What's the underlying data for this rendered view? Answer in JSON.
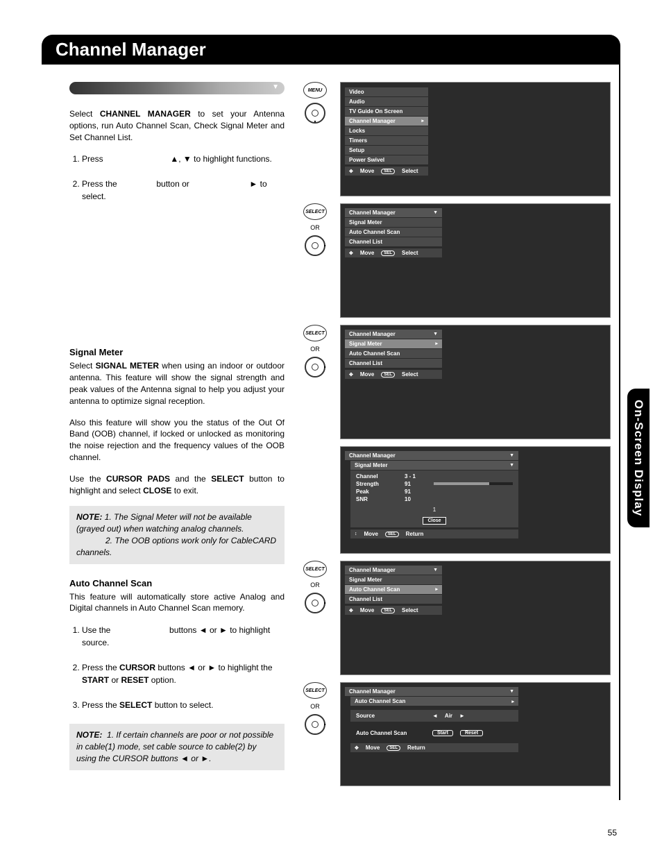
{
  "header": {
    "title": "Channel Manager"
  },
  "side_tab": "On-Screen Display",
  "page_number": "55",
  "intro": {
    "prefix": "Select ",
    "bold": "CHANNEL MANAGER",
    "suffix": " to set your Antenna options, run Auto Channel Scan, Check Signal Meter and Set Channel List."
  },
  "steps_main": {
    "s1_pre": "Press ",
    "s1_mid": ", ",
    "s1_post": " to highlight functions.",
    "s2_pre": "Press the ",
    "s2_mid": " button or ",
    "s2_post": " to select."
  },
  "up": "▲",
  "down": "▼",
  "left": "◄",
  "right": "►",
  "signal_meter": {
    "heading": "Signal Meter",
    "p1_pre": "Select ",
    "p1_bold": "SIGNAL METER",
    "p1_post": " when using an indoor or outdoor antenna. This feature will show the signal strength and peak values of the Antenna signal to help you adjust your antenna to optimize signal reception.",
    "p2": "Also this feature will show you the status of the Out Of Band (OOB) channel, if locked or unlocked as monitoring the noise rejection and the frequency values of the OOB channel.",
    "p3_a": "Use the ",
    "p3_b": "CURSOR PADS",
    "p3_c": " and the ",
    "p3_d": "SELECT",
    "p3_e": " button to highlight and select ",
    "p3_f": "CLOSE",
    "p3_g": " to exit.",
    "note_label": "NOTE:",
    "note1": "1. The Signal Meter will not be available (grayed out) when watching analog channels.",
    "note2": "2. The OOB options work only for CableCARD channels."
  },
  "auto_scan": {
    "heading": "Auto Channel Scan",
    "p1": "This feature will automatically store active Analog and Digital channels in Auto Channel Scan memory.",
    "s1_a": "Use the ",
    "s1_b": " buttons ",
    "s1_c": " or ",
    "s1_d": " to highlight source.",
    "s2_a": "Press the ",
    "s2_b": "CURSOR",
    "s2_c": " buttons ",
    "s2_d": " or ",
    "s2_e": " to highlight the ",
    "s2_f": "START",
    "s2_g": " or ",
    "s2_h": "RESET",
    "s2_i": " option.",
    "s3_a": "Press the ",
    "s3_b": "SELECT",
    "s3_c": " button to select.",
    "note_label": "NOTE:",
    "note1_a": "1. If certain channels are poor or not possible in cable(1) mode, set cable source to cable(2) by using the CURSOR buttons ",
    "note1_b": " or ",
    "note1_c": "."
  },
  "screens": {
    "main_menu": {
      "items": [
        "Video",
        "Audio",
        "TV Guide On Screen",
        "Channel Manager",
        "Locks",
        "Timers",
        "Setup",
        "Power Swivel"
      ],
      "selected_index": 3,
      "footer_move": "Move",
      "footer_sel": "SEL",
      "footer_select": "Select"
    },
    "cm_menu": {
      "title": "Channel Manager",
      "items": [
        "Signal Meter",
        "Auto Channel Scan",
        "Channel List"
      ],
      "footer_move": "Move",
      "footer_sel": "SEL",
      "footer_select": "Select"
    },
    "cm_signal": {
      "title": "Channel Manager",
      "items": [
        "Signal Meter",
        "Auto Channel Scan",
        "Channel List"
      ],
      "selected_index": 0
    },
    "meter": {
      "title1": "Channel Manager",
      "title2": "Signal Meter",
      "rows": [
        {
          "lbl": "Channel",
          "val": "3 - 1"
        },
        {
          "lbl": "Strength",
          "val": "91"
        },
        {
          "lbl": "Peak",
          "val": "91"
        },
        {
          "lbl": "SNR",
          "val": "10"
        }
      ],
      "one": "1",
      "close": "Close",
      "footer_move": "Move",
      "footer_sel": "SEL",
      "footer_return": "Return"
    },
    "cm_acs": {
      "title": "Channel Manager",
      "items": [
        "Signal Meter",
        "Auto Channel Scan",
        "Channel List"
      ],
      "selected_index": 1
    },
    "acs": {
      "title1": "Channel Manager",
      "title2": "Auto Channel Scan",
      "source_lbl": "Source",
      "source_val": "Air",
      "acs_lbl": "Auto Channel Scan",
      "start": "Start",
      "reset": "Reset",
      "footer_move": "Move",
      "footer_sel": "SEL",
      "footer_return": "Return"
    }
  },
  "remote": {
    "menu": "MENU",
    "select": "SELECT",
    "or": "OR"
  }
}
